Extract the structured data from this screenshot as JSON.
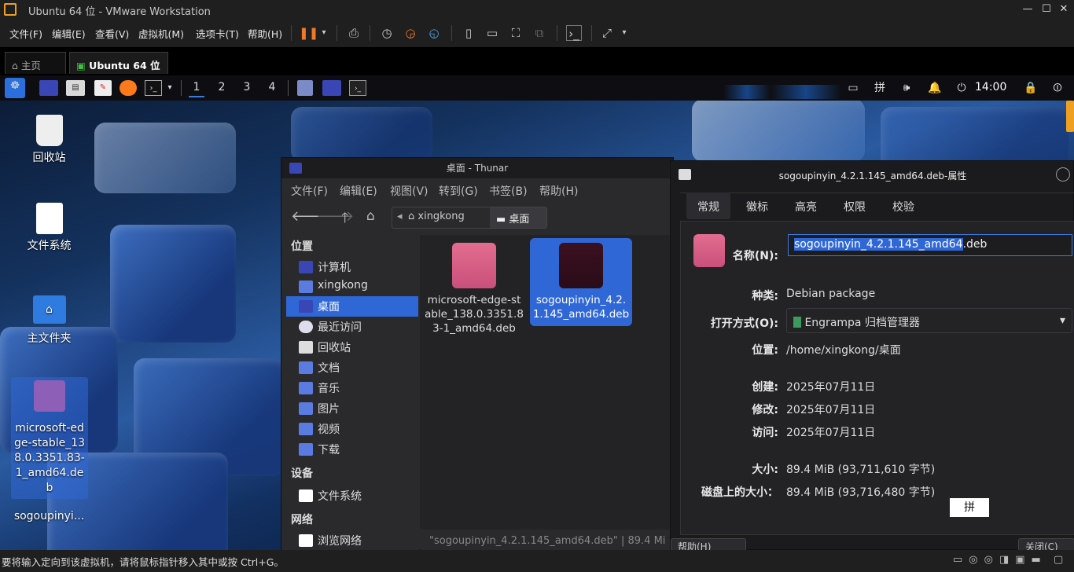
{
  "vm": {
    "title": "Ubuntu 64 位 - VMware Workstation",
    "menu": [
      "文件(F)",
      "编辑(E)",
      "查看(V)",
      "虚拟机(M)",
      "选项卡(T)",
      "帮助(H)"
    ],
    "tabs": [
      {
        "label": "主页"
      },
      {
        "label": "Ubuntu 64 位"
      }
    ],
    "status": "要将输入定向到该虚拟机，请将鼠标指针移入其中或按 Ctrl+G。"
  },
  "panel": {
    "workspaces": [
      "1",
      "2",
      "3",
      "4"
    ],
    "clock": "14:00"
  },
  "desktop": {
    "icons": [
      "回收站",
      "文件系统",
      "主文件夹",
      "microsoft-edge-stable_138.0.3351.83-1_amd64.deb",
      "sogoupinyi..."
    ]
  },
  "thunar": {
    "title": "桌面 - Thunar",
    "menu": [
      "文件(F)",
      "编辑(E)",
      "视图(V)",
      "转到(G)",
      "书签(B)",
      "帮助(H)"
    ],
    "path": [
      "xingkong",
      "桌面"
    ],
    "sections": {
      "places": "位置",
      "devices": "设备",
      "network": "网络"
    },
    "places": [
      "计算机",
      "xingkong",
      "桌面",
      "最近访问",
      "回收站",
      "文档",
      "音乐",
      "图片",
      "视频",
      "下载"
    ],
    "devices": [
      "文件系统"
    ],
    "network": [
      "浏览网络"
    ],
    "files": [
      {
        "name": "microsoft-edge-stable_138.0.3351.83-1_amd64.deb",
        "selected": false
      },
      {
        "name": "sogoupinyin_4.2.1.145_amd64.deb",
        "selected": true
      }
    ],
    "statusbar": "\"sogoupinyin_4.2.1.145_amd64.deb\" | 89.4 Mi"
  },
  "props": {
    "title": "sogoupinyin_4.2.1.145_amd64.deb-属性",
    "tabs": [
      "常规",
      "徽标",
      "高亮",
      "权限",
      "校验"
    ],
    "name_label": "名称(N):",
    "name_selected": "sogoupinyin_4.2.1.145_amd64",
    "name_ext": ".deb",
    "rows": [
      {
        "label": "种类:",
        "value": "Debian package"
      },
      {
        "label": "打开方式(O):",
        "value": "Engrampa 归档管理器"
      },
      {
        "label": "位置:",
        "value": "/home/xingkong/桌面"
      },
      {
        "label": "创建:",
        "value": "2025年07月11日"
      },
      {
        "label": "修改:",
        "value": "2025年07月11日"
      },
      {
        "label": "访问:",
        "value": "2025年07月11日"
      },
      {
        "label": "大小:",
        "value": "89.4 MiB (93,711,610 字节)"
      },
      {
        "label": "磁盘上的大小：",
        "value": "89.4 MiB (93,716,480 字节)"
      }
    ],
    "ime_indicator": "拼",
    "help_button": "帮助(H)",
    "close_button": "关闭(C)"
  },
  "colors": {
    "selection": "#2f67d6",
    "accent": "#3b7bdc",
    "pkg": "#d85f85"
  }
}
